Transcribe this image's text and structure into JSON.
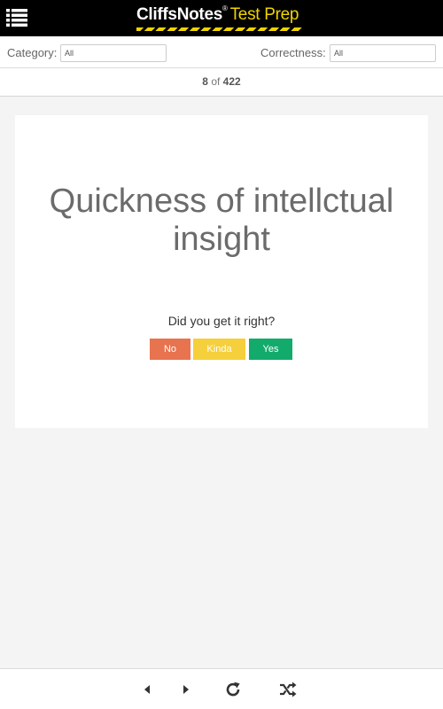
{
  "header": {
    "brand": "CliffsNotes",
    "brand_mark": "®",
    "product": "Test Prep",
    "menu_icon": "list-menu-icon",
    "accent_color": "#f0d400"
  },
  "filters": {
    "category_label": "Category:",
    "category_value": "All",
    "correctness_label": "Correctness:",
    "correctness_value": "All"
  },
  "progress": {
    "current": "8",
    "separator": "of",
    "total": "422"
  },
  "card": {
    "term": "Quickness of intellctual insight",
    "prompt": "Did you get it right?",
    "buttons": {
      "no": "No",
      "kinda": "Kinda",
      "yes": "Yes"
    },
    "button_colors": {
      "no": "#e8734f",
      "kinda": "#f6cf3c",
      "yes": "#13ab6b"
    }
  },
  "toolbar": {
    "icons": [
      "caret-left-icon",
      "caret-right-icon",
      "reload-icon",
      "shuffle-icon"
    ]
  }
}
